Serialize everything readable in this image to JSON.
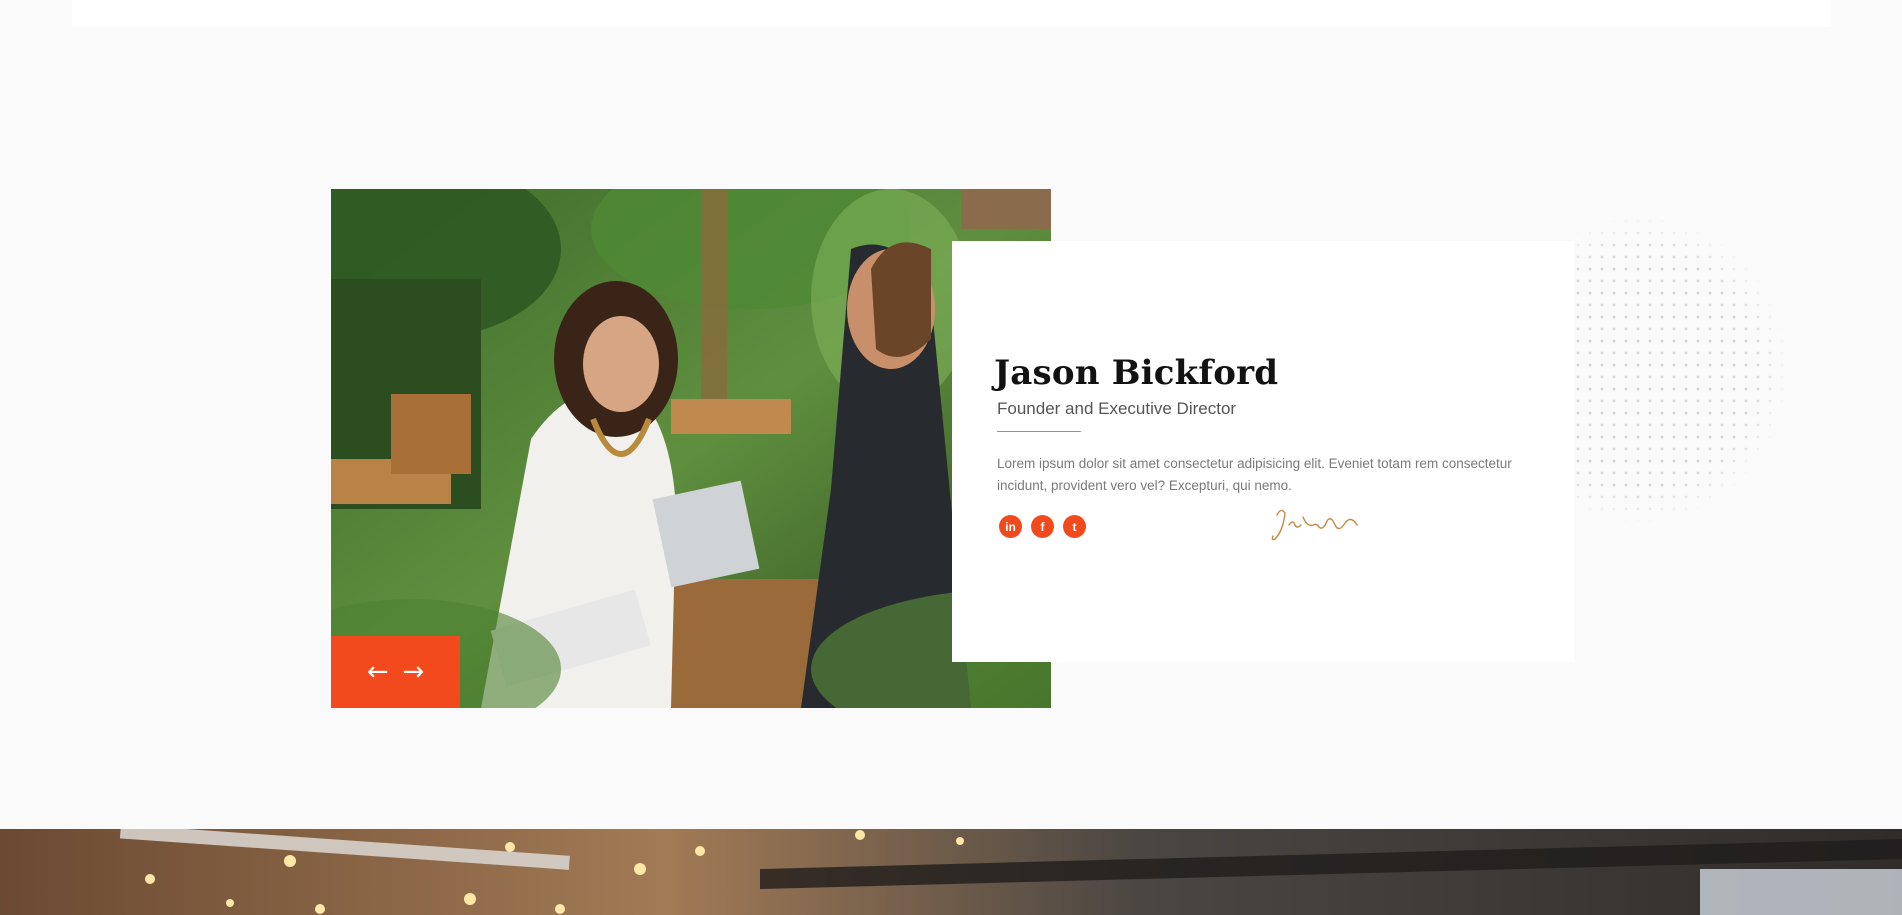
{
  "profile": {
    "name": "Jason Bickford",
    "role": "Founder and Executive Director",
    "bio": "Lorem ipsum dolor sit amet consectetur adipisicing elit. Eveniet totam rem consectetur incidunt, provident vero vel? Excepturi, qui nemo.",
    "signature": "Jason Brick"
  },
  "slider": {
    "prev_icon": "←",
    "next_icon": "→"
  },
  "socials": [
    {
      "icon": "linkedin-icon",
      "glyph": "in"
    },
    {
      "icon": "facebook-icon",
      "glyph": "f"
    },
    {
      "icon": "twitter-icon",
      "glyph": "t"
    }
  ],
  "colors": {
    "accent": "#f24a1d",
    "divider": "#c58a45",
    "background": "#fafafa"
  }
}
